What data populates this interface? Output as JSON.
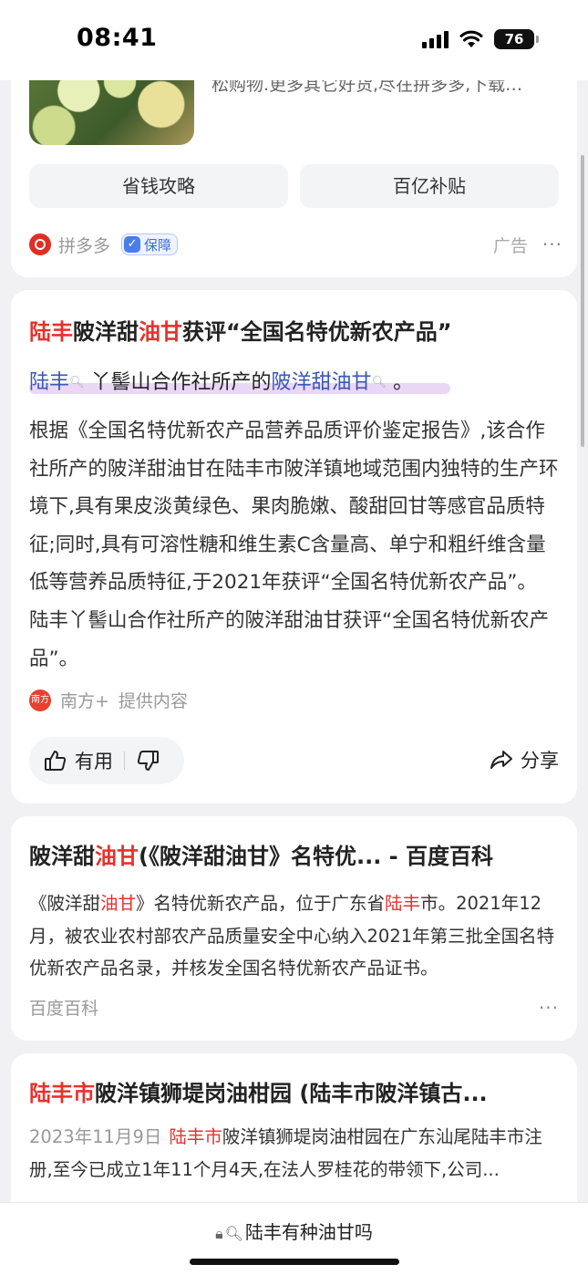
{
  "status_bar": {
    "time": "08:41",
    "battery": "76"
  },
  "ad_card": {
    "desc": "松购物.更多其它好货,尽在拼多多,下载…",
    "buttons": [
      "省钱攻略",
      "百亿补贴"
    ],
    "source": "拼多多",
    "guarantee": "保障",
    "ad_label": "广告",
    "more": "···"
  },
  "answer": {
    "title": [
      "陆丰",
      "陂洋甜",
      "油甘",
      "获评“全国名特优新农产品”"
    ],
    "subtitle": [
      "陆丰",
      "丫髻山合作社所产的",
      "陂洋甜油甘",
      "。"
    ],
    "body": "根据《全国名特优新农产品营养品质评价鉴定报告》,该合作社所产的陂洋甜油甘在陆丰市陂洋镇地域范围内独特的生产环境下,具有果皮淡黄绿色、果肉脆嫩、酸甜回甘等感官品质特征;同时,具有可溶性糖和维生素C含量高、单宁和粗纤维含量低等营养品质特征,于2021年获评“全国名特优新农产品”。 陆丰丫髻山合作社所产的陂洋甜油甘获评“全国名特优新农产品”。",
    "source": "南方+",
    "provided": "提供内容",
    "useful": "有用",
    "share": "分享"
  },
  "result1": {
    "title": [
      "陂洋甜",
      "油甘",
      "(《陂洋甜油甘》名特优... - 百度百科"
    ],
    "body": [
      "《陂洋甜",
      "油甘",
      "》名特优新农产品，位于广东省",
      "陆丰",
      "市。2021年12月，被农业农村部农产品质量安全中心纳入2021年第三批全国名特优新农产品名录，并核发全国名特优新农产品证书。"
    ],
    "source": "百度百科",
    "more": "···"
  },
  "result2": {
    "title": [
      "陆丰市",
      "陂洋镇狮堤岗油柑园 (陆丰市陂洋镇古..."
    ],
    "date": "2023年11月9日",
    "body": [
      "陆丰市",
      "陂洋镇狮堤岗油柑园在广东汕尾陆丰市注册,至今已成立1年11个月4天,在法人罗桂花的带领下,公司..."
    ]
  },
  "bottom": {
    "query": "陆丰有种油甘吗"
  },
  "colors": {
    "highlight_red": "#e6322d",
    "link_blue": "#3a56b8"
  }
}
